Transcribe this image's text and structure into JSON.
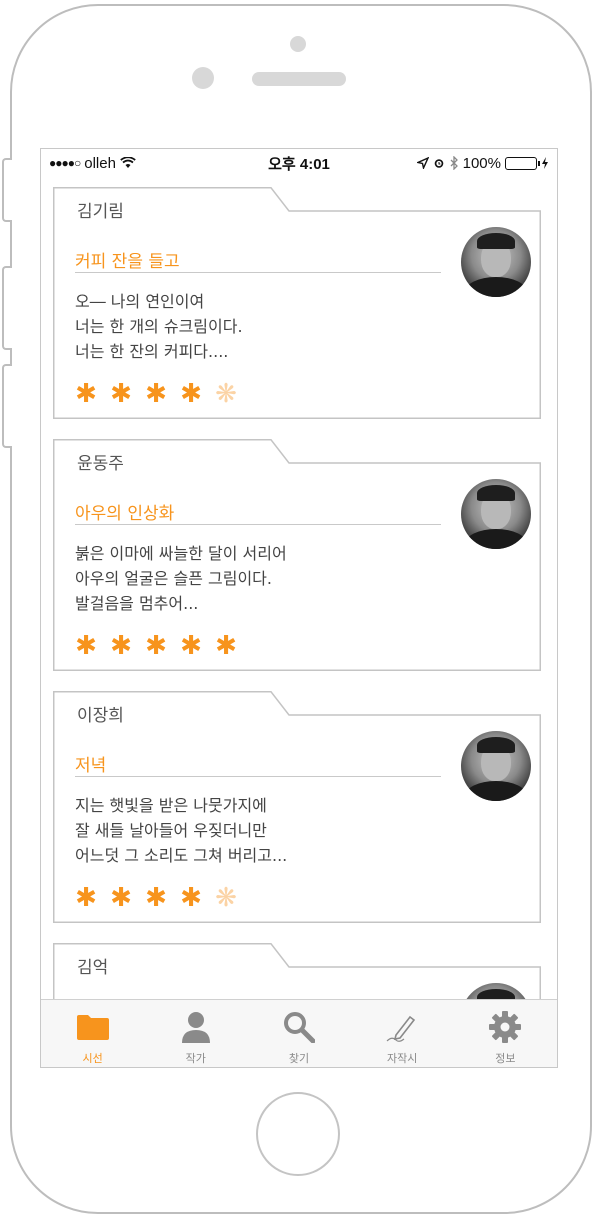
{
  "status_bar": {
    "carrier": "olleh",
    "time": "오후 4:01",
    "battery_percent": "100%",
    "battery_level": 1.0
  },
  "poems": [
    {
      "author": "김기림",
      "title": "커피 잔을 들고",
      "lines": [
        "오― 나의 연인이여",
        "너는 한 개의 슈크림이다.",
        "너는 한 잔의 커피다...."
      ],
      "rating": 4,
      "max_rating": 5
    },
    {
      "author": "윤동주",
      "title": "아우의 인상화",
      "lines": [
        "붉은 이마에 싸늘한 달이 서리어",
        "아우의 얼굴은 슬픈 그림이다.",
        "발걸음을 멈추어..."
      ],
      "rating": 5,
      "max_rating": 5
    },
    {
      "author": "이장희",
      "title": "저녁",
      "lines": [
        "지는 햇빛을 받은 나뭇가지에",
        "잘 새들 날아들어 우짖더니만",
        "어느덧 그 소리도 그쳐 버리고..."
      ],
      "rating": 4,
      "max_rating": 5
    },
    {
      "author": "김억",
      "title": "",
      "lines": [],
      "rating": 0,
      "max_rating": 5
    }
  ],
  "tabs": [
    {
      "label": "시선",
      "icon": "folder-icon",
      "active": true
    },
    {
      "label": "작가",
      "icon": "person-icon",
      "active": false
    },
    {
      "label": "찾기",
      "icon": "search-icon",
      "active": false
    },
    {
      "label": "자작시",
      "icon": "pen-icon",
      "active": false
    },
    {
      "label": "정보",
      "icon": "gear-icon",
      "active": false
    }
  ],
  "colors": {
    "accent": "#f7941d",
    "star_empty": "#fbd3a5",
    "inactive": "#8a8a8a"
  }
}
